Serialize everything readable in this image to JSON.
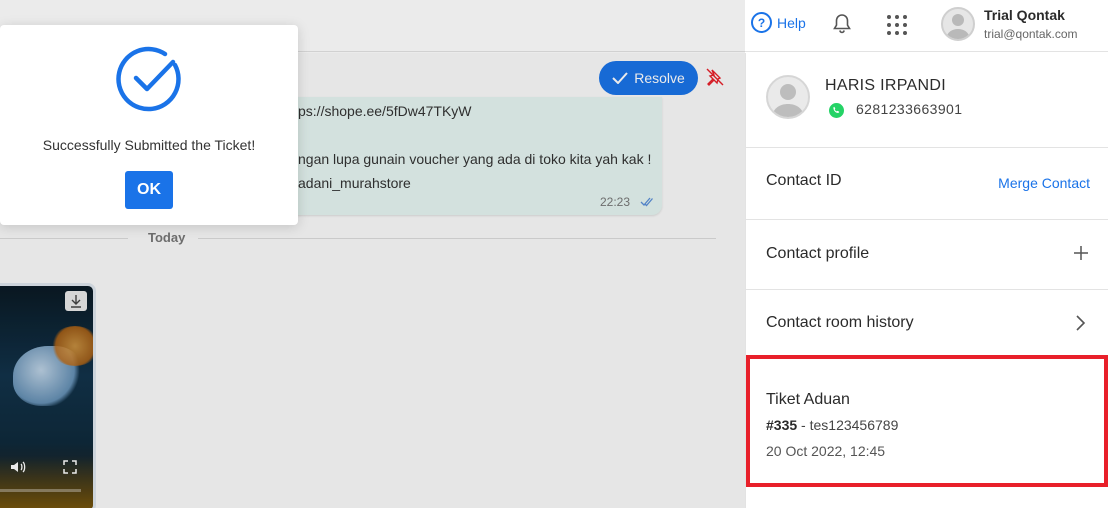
{
  "header": {
    "help_label": "Help",
    "user": {
      "name": "Trial Qontak",
      "email": "trial@qontak.com"
    }
  },
  "chat": {
    "resolve_label": "Resolve",
    "bubble_lines": [
      "ps://shope.ee/5fDw47TKyW",
      "ngan lupa gunain voucher yang ada di toko kita yah kak !",
      "adani_murahstore"
    ],
    "bubble_time": "22:23",
    "date_divider": "Today"
  },
  "modal": {
    "message": "Successfully Submitted the Ticket!",
    "ok_label": "OK"
  },
  "contact": {
    "name": "HARIS IRPANDI",
    "phone": "6281233663901",
    "contact_id_label": "Contact ID",
    "merge_label": "Merge Contact",
    "profile_label": "Contact profile",
    "history_label": "Contact room history"
  },
  "ticket": {
    "title": "Tiket Aduan",
    "number": "#335",
    "separator": " - ",
    "subject": "tes123456789",
    "date": "20 Oct 2022, 12:45"
  },
  "colors": {
    "accent": "#1a73e8",
    "highlight": "#e8202a",
    "whatsapp": "#25d366"
  }
}
